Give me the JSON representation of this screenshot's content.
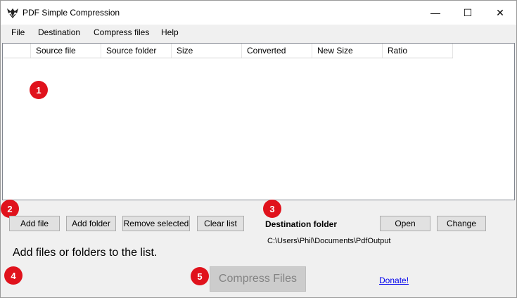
{
  "window": {
    "title": "PDF Simple Compression",
    "controls": {
      "minimize_glyph": "—",
      "maximize_glyph": "☐",
      "close_glyph": "✕"
    }
  },
  "menu": [
    "File",
    "Destination",
    "Compress files",
    "Help"
  ],
  "file_list": {
    "columns": [
      "",
      "Source file",
      "Source folder",
      "Size",
      "Converted",
      "New Size",
      "Ratio"
    ],
    "rows": []
  },
  "buttons": {
    "add_file": "Add file",
    "add_folder": "Add folder",
    "remove_selected": "Remove selected",
    "clear_list": "Clear list",
    "open": "Open",
    "change": "Change",
    "compress_files": "Compress Files"
  },
  "destination": {
    "label": "Destination folder",
    "path": "C:\\Users\\Phil\\Documents\\PdfOutput"
  },
  "status_message": "Add files or folders to the list.",
  "donate_link": "Donate!",
  "markers": [
    "1",
    "2",
    "3",
    "4",
    "5"
  ],
  "colors": {
    "marker": "#e0121c",
    "link": "#0000ee",
    "disabled_button": "#cccccc"
  }
}
